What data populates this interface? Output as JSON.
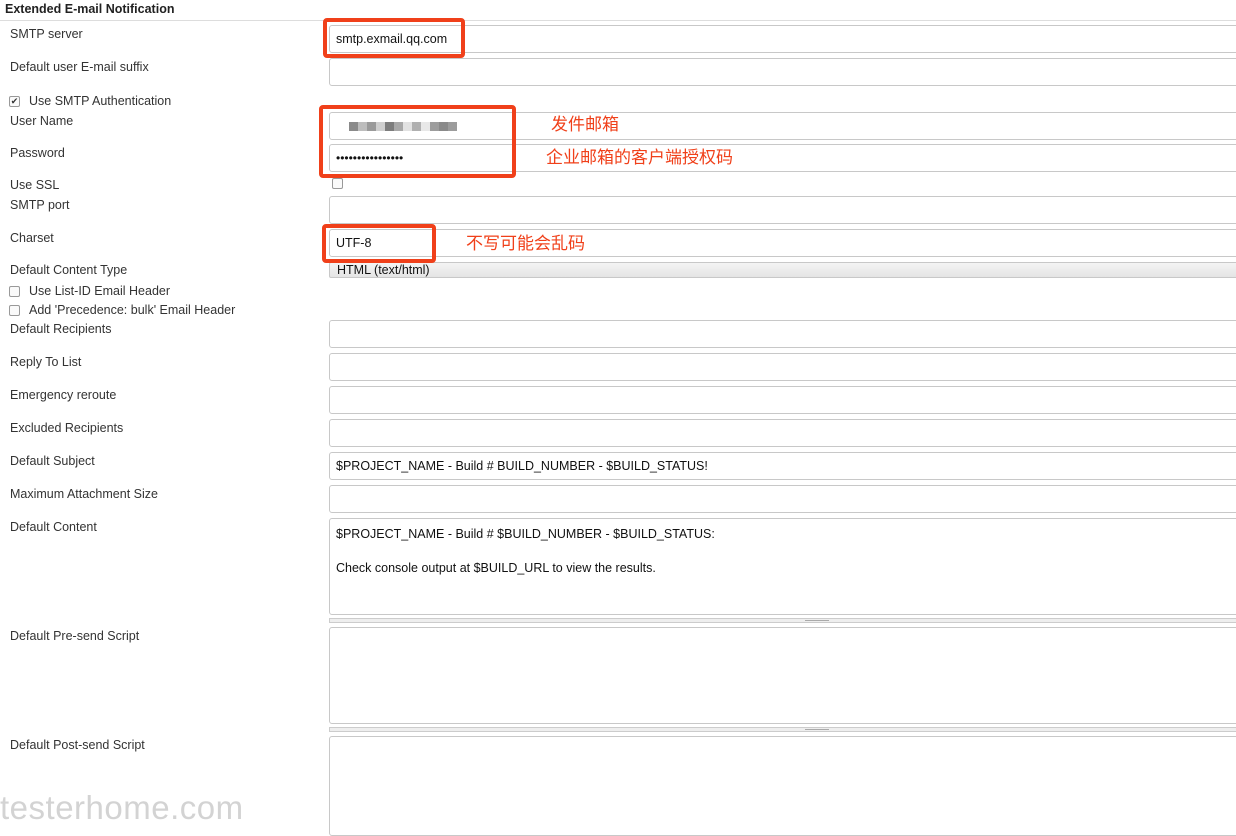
{
  "section": {
    "title": "Extended E-mail Notification"
  },
  "fields": {
    "smtp_server": {
      "label": "SMTP server",
      "value": "smtp.exmail.qq.com"
    },
    "default_suffix": {
      "label": "Default user E-mail suffix",
      "value": ""
    },
    "use_smtp_auth": {
      "label": "Use SMTP Authentication",
      "checked": true
    },
    "user_name": {
      "label": "User Name"
    },
    "password": {
      "label": "Password",
      "value": "••••••••••••••••"
    },
    "use_ssl": {
      "label": "Use SSL",
      "checked": false
    },
    "smtp_port": {
      "label": "SMTP port",
      "value": ""
    },
    "charset": {
      "label": "Charset",
      "value": "UTF-8"
    },
    "content_type": {
      "label": "Default Content Type",
      "value": "HTML (text/html)"
    },
    "list_id": {
      "label": "Use List-ID Email Header",
      "checked": false
    },
    "precedence": {
      "label": "Add 'Precedence: bulk' Email Header",
      "checked": false
    },
    "recipients": {
      "label": "Default Recipients",
      "value": ""
    },
    "reply_to": {
      "label": "Reply To List",
      "value": ""
    },
    "reroute": {
      "label": "Emergency reroute",
      "value": ""
    },
    "excluded": {
      "label": "Excluded Recipients",
      "value": ""
    },
    "subject": {
      "label": "Default Subject",
      "value": "$PROJECT_NAME - Build # BUILD_NUMBER - $BUILD_STATUS!"
    },
    "max_attach": {
      "label": "Maximum Attachment Size",
      "value": ""
    },
    "content": {
      "label": "Default Content",
      "value": "$PROJECT_NAME - Build # $BUILD_NUMBER - $BUILD_STATUS:\n\nCheck console output at $BUILD_URL to view the results."
    },
    "pre_send": {
      "label": "Default Pre-send Script",
      "value": ""
    },
    "post_send": {
      "label": "Default Post-send Script",
      "value": ""
    }
  },
  "annotations": {
    "sender_mailbox": "发件邮箱",
    "client_auth_code": "企业邮箱的客户端授权码",
    "charset_note": "不写可能会乱码"
  },
  "watermark": "testerhome.com",
  "colors": {
    "highlight": "#f0401a",
    "border": "#c8c8c8"
  }
}
